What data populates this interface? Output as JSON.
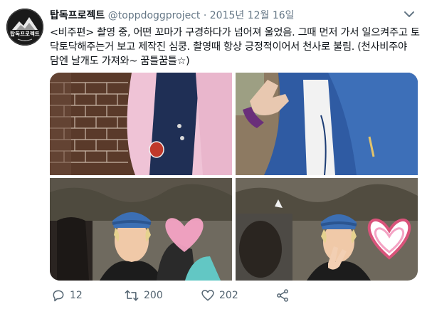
{
  "tweet": {
    "author_name": "탑독프로젝트",
    "handle": "@toppdoggproject",
    "separator": "·",
    "date": "2015년 12월 16일",
    "avatar_text": "탑독프로젝트",
    "text_lines": [
      "<비주편> 촬영 중, 어떤 꼬마가 구경하다가 넘어져 울었음. 그때 먼저 가서 일으켜주고 토",
      "닥토닥해주는거 보고 제작진 심쿵. 촬영때 항상 긍정적이어서 천사로 불림. (천사비주야",
      "담엔 날개도 가져와~ 꿈틀꿈틀☆)"
    ]
  },
  "actions": {
    "reply_count": "12",
    "retweet_count": "200",
    "like_count": "202"
  },
  "icons": {
    "reply": "reply-icon",
    "retweet": "retweet-icon",
    "like": "heart-icon",
    "share": "share-icon",
    "more": "more-dots-icon"
  },
  "colors": {
    "text_primary": "#0f1419",
    "text_secondary": "#657786",
    "icon_gray": "#536471",
    "jacket_blue": "#2a4a8c",
    "cap_blue": "#3b6fb0",
    "pink_heart": "#f4a3c4"
  }
}
